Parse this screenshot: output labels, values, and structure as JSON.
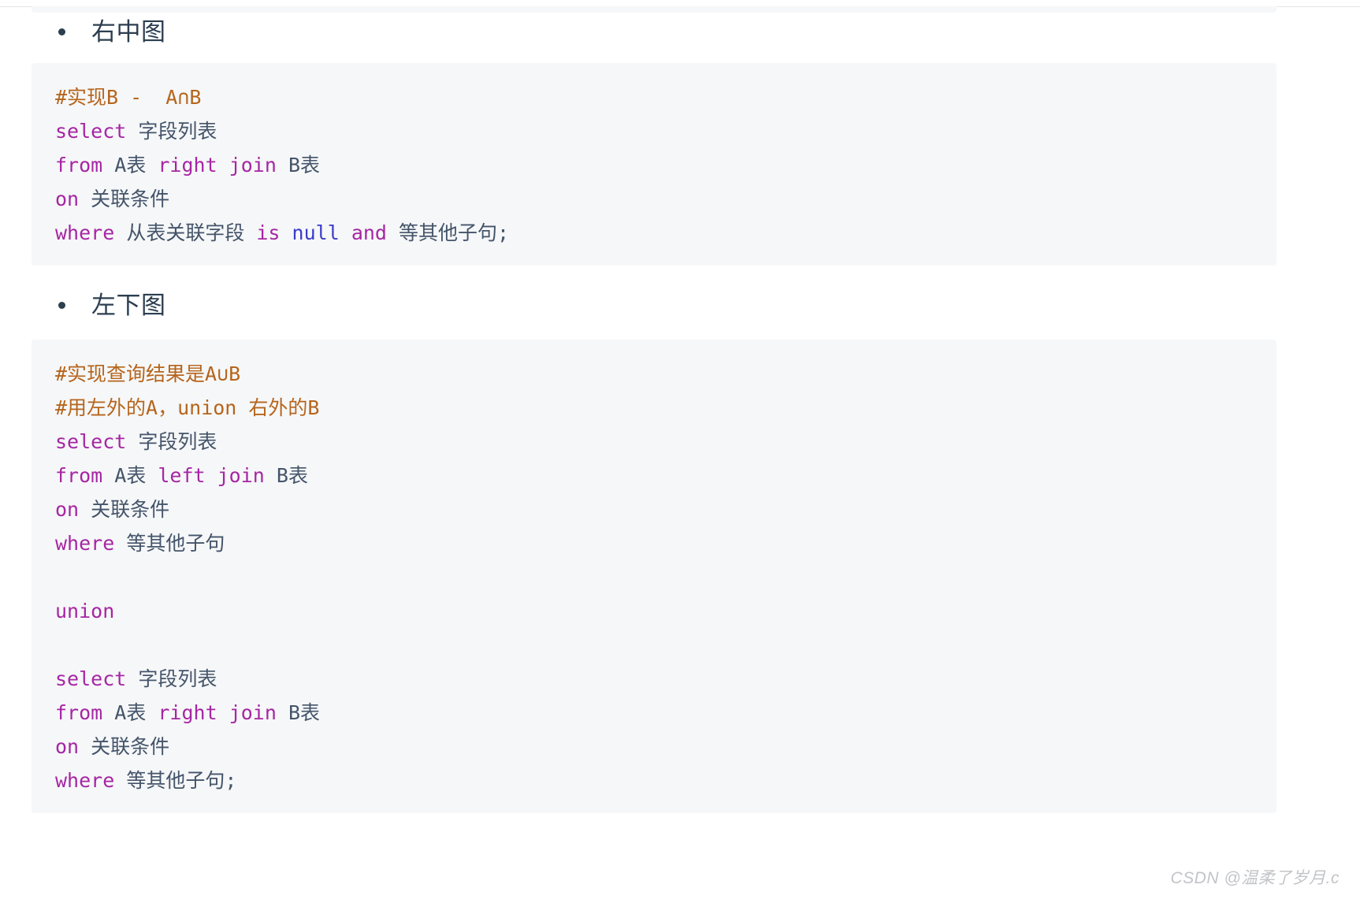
{
  "page": {
    "background": "#ffffff",
    "code_background": "#f6f7f8",
    "heading_color": "#2c3e50",
    "comment_color": "#b5651d",
    "keyword_color": "#a626a4",
    "null_color": "#3b3bc8",
    "plain_color": "#44546a"
  },
  "sections": [
    {
      "heading": "右中图",
      "code_lines": [
        {
          "tokens": [
            {
              "text": "#实现B -  A∩B",
              "kind": "comment"
            }
          ]
        },
        {
          "tokens": [
            {
              "text": "select",
              "kind": "keyword"
            },
            {
              "text": " 字段列表",
              "kind": "plain"
            }
          ]
        },
        {
          "tokens": [
            {
              "text": "from",
              "kind": "keyword"
            },
            {
              "text": " A表 ",
              "kind": "plain"
            },
            {
              "text": "right join",
              "kind": "keyword"
            },
            {
              "text": " B表",
              "kind": "plain"
            }
          ]
        },
        {
          "tokens": [
            {
              "text": "on",
              "kind": "keyword"
            },
            {
              "text": " 关联条件",
              "kind": "plain"
            }
          ]
        },
        {
          "tokens": [
            {
              "text": "where",
              "kind": "keyword"
            },
            {
              "text": " 从表关联字段 ",
              "kind": "plain"
            },
            {
              "text": "is",
              "kind": "keyword"
            },
            {
              "text": " ",
              "kind": "plain"
            },
            {
              "text": "null",
              "kind": "null"
            },
            {
              "text": " ",
              "kind": "plain"
            },
            {
              "text": "and",
              "kind": "keyword"
            },
            {
              "text": " 等其他子句;",
              "kind": "plain"
            }
          ]
        }
      ]
    },
    {
      "heading": "左下图",
      "code_lines": [
        {
          "tokens": [
            {
              "text": "#实现查询结果是A∪B",
              "kind": "comment"
            }
          ]
        },
        {
          "tokens": [
            {
              "text": "#用左外的A，union 右外的B",
              "kind": "comment"
            }
          ]
        },
        {
          "tokens": [
            {
              "text": "select",
              "kind": "keyword"
            },
            {
              "text": " 字段列表",
              "kind": "plain"
            }
          ]
        },
        {
          "tokens": [
            {
              "text": "from",
              "kind": "keyword"
            },
            {
              "text": " A表 ",
              "kind": "plain"
            },
            {
              "text": "left join",
              "kind": "keyword"
            },
            {
              "text": " B表",
              "kind": "plain"
            }
          ]
        },
        {
          "tokens": [
            {
              "text": "on",
              "kind": "keyword"
            },
            {
              "text": " 关联条件",
              "kind": "plain"
            }
          ]
        },
        {
          "tokens": [
            {
              "text": "where",
              "kind": "keyword"
            },
            {
              "text": " 等其他子句",
              "kind": "plain"
            }
          ]
        },
        {
          "tokens": []
        },
        {
          "tokens": [
            {
              "text": "union",
              "kind": "keyword"
            }
          ]
        },
        {
          "tokens": []
        },
        {
          "tokens": [
            {
              "text": "select",
              "kind": "keyword"
            },
            {
              "text": " 字段列表",
              "kind": "plain"
            }
          ]
        },
        {
          "tokens": [
            {
              "text": "from",
              "kind": "keyword"
            },
            {
              "text": " A表 ",
              "kind": "plain"
            },
            {
              "text": "right join",
              "kind": "keyword"
            },
            {
              "text": " B表",
              "kind": "plain"
            }
          ]
        },
        {
          "tokens": [
            {
              "text": "on",
              "kind": "keyword"
            },
            {
              "text": " 关联条件",
              "kind": "plain"
            }
          ]
        },
        {
          "tokens": [
            {
              "text": "where",
              "kind": "keyword"
            },
            {
              "text": " 等其他子句;",
              "kind": "plain"
            }
          ]
        }
      ]
    }
  ],
  "watermark": {
    "text": "CSDN @温柔了岁月.c"
  }
}
